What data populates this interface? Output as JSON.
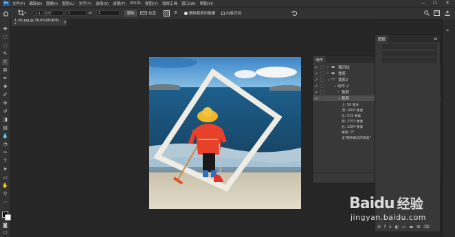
{
  "menubar": {
    "logo": "Ps",
    "items": [
      "文件(F)",
      "编辑(E)",
      "图像(I)",
      "图层(L)",
      "文字(Y)",
      "选择(S)",
      "滤镜(T)",
      "3D(D)",
      "视图(V)",
      "增效工具",
      "窗口(W)",
      "帮助(H)"
    ],
    "min": "—",
    "max": "☐",
    "close": "✕"
  },
  "optbar": {
    "ratio": "1:1（方形）",
    "w": "1",
    "h": "1",
    "clear": "清除",
    "straighten": "拉直",
    "delete_pixels": "删除裁剪的像素",
    "content_aware": "内容识别"
  },
  "doc": {
    "tab": "1 (4).jpg @ 36.6%(RGB/8) *",
    "close": "×"
  },
  "actions": {
    "title": "动作",
    "rows": [
      {
        "label": "我闪线",
        "folder": true,
        "open": false
      },
      {
        "label": "我剪",
        "folder": true,
        "open": false
      },
      {
        "label": "我剪2",
        "folder": true,
        "open": true
      },
      {
        "label": "动作 2",
        "folder": false
      },
      {
        "label": "裁剪",
        "folder": false
      },
      {
        "label": "裁剪",
        "folder": false,
        "selected": true
      }
    ],
    "details": [
      "上: 50 厘米",
      "顶: 2000 像素",
      "左: 531 像素",
      "底: 3753 像素",
      "右: 2284 像素",
      "角度: 0°",
      "含\"删除裁剪的像素\""
    ]
  },
  "props": {
    "title": "图层"
  },
  "watermark": {
    "brand": "Baidu",
    "brand_cn": "经验",
    "url": "jingyan.baidu.com"
  }
}
